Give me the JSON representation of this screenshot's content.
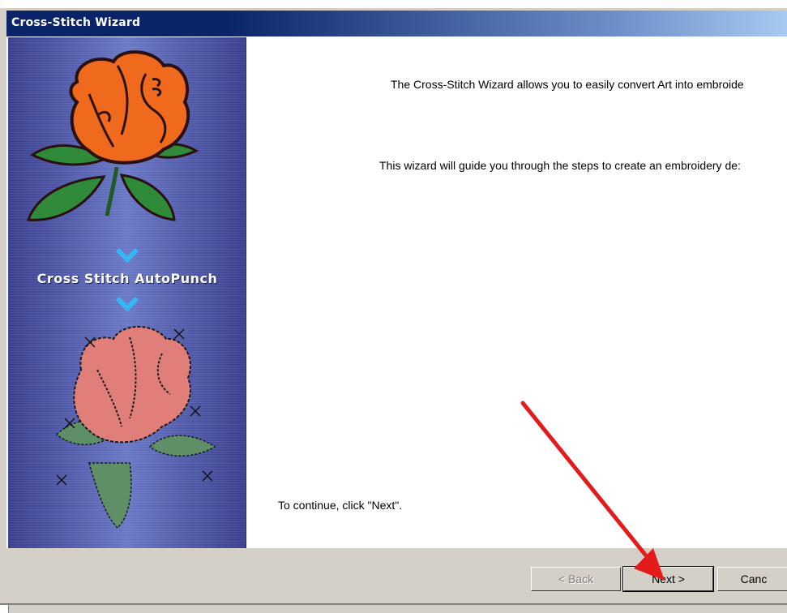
{
  "window": {
    "title": "Cross-Stitch Wizard"
  },
  "sidebar": {
    "label": "Cross Stitch AutoPunch",
    "images": [
      "rose-illustration",
      "cross-stitch-rose-illustration"
    ],
    "arrows": [
      "chevron-down-icon",
      "chevron-down-icon"
    ]
  },
  "main": {
    "intro_text": "The Cross-Stitch Wizard allows you to easily convert Art into embroide",
    "guide_text": "This wizard will guide you through the steps to create an embroidery de:",
    "continue_text": "To continue, click \"Next\"."
  },
  "buttons": {
    "back_label": "< Back",
    "next_label": "Next >",
    "cancel_label": "Canc"
  },
  "annotation": {
    "arrow_color": "#e31b1b",
    "icon": "red-arrow-icon"
  },
  "colors": {
    "titlebar_start": "#0a246a",
    "titlebar_end": "#a6caf0",
    "dialog_bg": "#d4d0c8",
    "sidebar": "#5a67b8"
  }
}
